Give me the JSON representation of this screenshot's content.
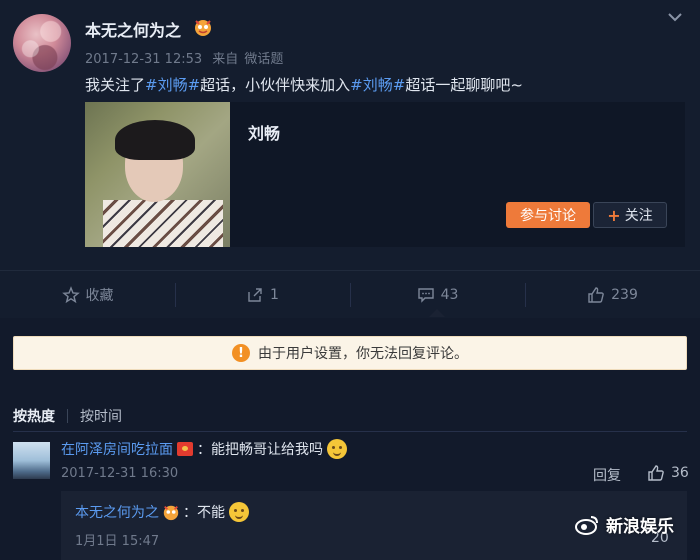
{
  "post": {
    "username": "本无之何为之",
    "timestamp": "2017-12-31 12:53",
    "source_prefix": "来自",
    "source": "微话题",
    "text_parts": [
      "我关注了",
      "#刘畅#",
      "超话，小伙伴快来加入",
      "#刘畅#",
      "超话一起聊聊吧~"
    ]
  },
  "topic_card": {
    "title": "刘畅",
    "discuss_label": "参与讨论",
    "follow_label": "关注"
  },
  "actions": {
    "favorite_label": "收藏",
    "repost_count": "1",
    "comment_count": "43",
    "like_count": "239"
  },
  "notice": {
    "text": "由于用户设置，你无法回复评论。"
  },
  "sort": {
    "hot_label": "按热度",
    "time_label": "按时间"
  },
  "comments": [
    {
      "author": "在阿泽房间吃拉面",
      "text": "：能把畅哥让给我吗",
      "time": "2017-12-31 16:30",
      "reply_label": "回复",
      "likes": "36"
    }
  ],
  "sub_comment": {
    "author": "本无之何为之",
    "text": "：不能",
    "time": "1月1日 15:47",
    "likes": "20"
  },
  "watermark": {
    "text": "新浪娱乐"
  },
  "colors": {
    "background": "#121a2b",
    "accent_link": "#5b9bf0",
    "discuss_button": "#ee7a3a",
    "notice_bg": "#fbf4e7"
  }
}
